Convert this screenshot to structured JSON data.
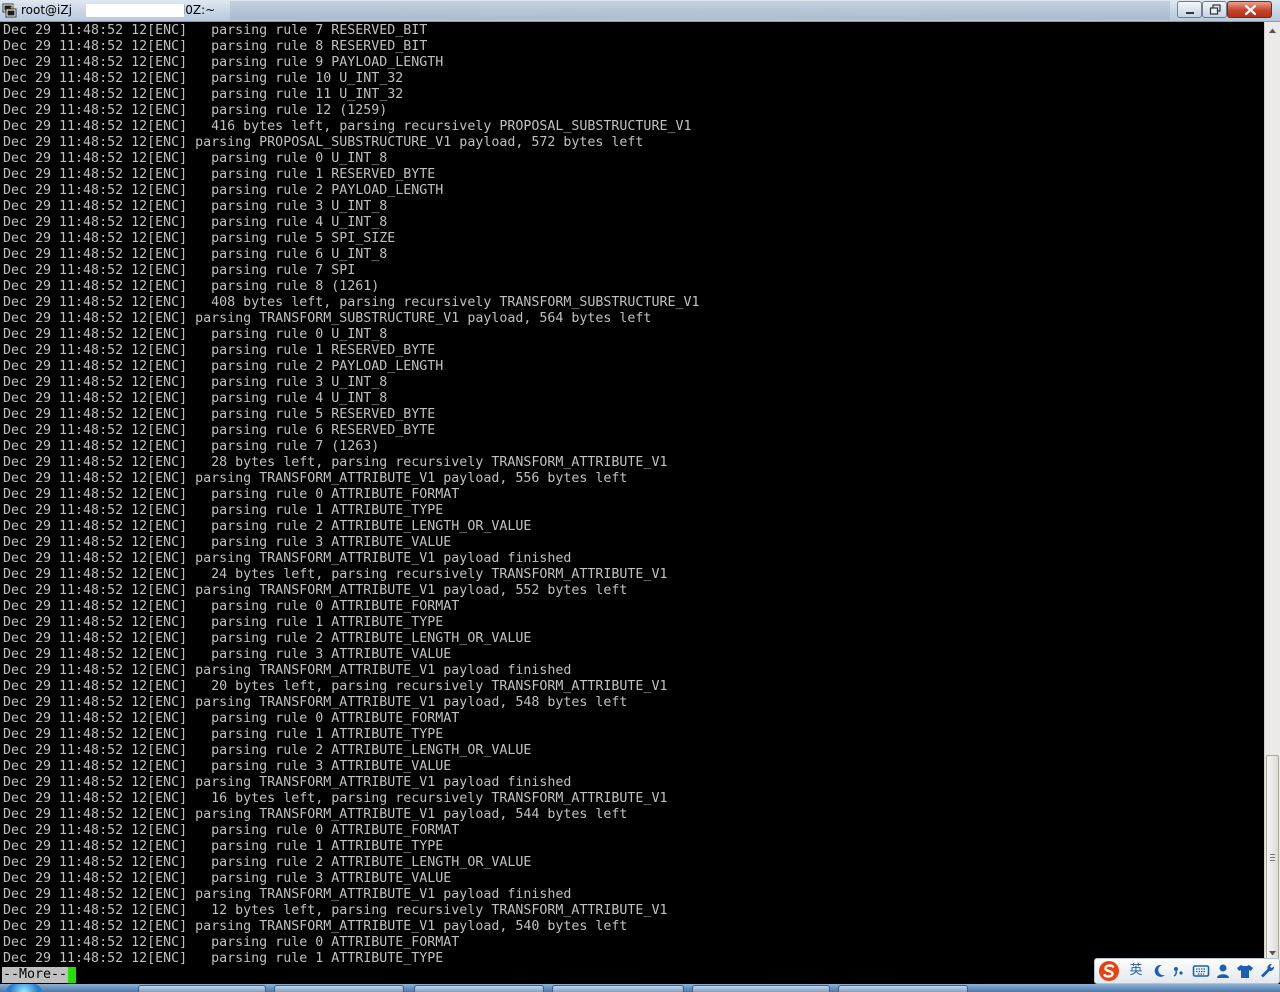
{
  "window": {
    "title": "root@iZj",
    "title_suffix": "l0Z:~",
    "minimize_label": "",
    "maximize_label": "",
    "close_label": ""
  },
  "terminal": {
    "lines": [
      "Dec 29 11:48:52 12[ENC]   parsing rule 7 RESERVED_BIT",
      "Dec 29 11:48:52 12[ENC]   parsing rule 8 RESERVED_BIT",
      "Dec 29 11:48:52 12[ENC]   parsing rule 9 PAYLOAD_LENGTH",
      "Dec 29 11:48:52 12[ENC]   parsing rule 10 U_INT_32",
      "Dec 29 11:48:52 12[ENC]   parsing rule 11 U_INT_32",
      "Dec 29 11:48:52 12[ENC]   parsing rule 12 (1259)",
      "Dec 29 11:48:52 12[ENC]   416 bytes left, parsing recursively PROPOSAL_SUBSTRUCTURE_V1",
      "Dec 29 11:48:52 12[ENC] parsing PROPOSAL_SUBSTRUCTURE_V1 payload, 572 bytes left",
      "Dec 29 11:48:52 12[ENC]   parsing rule 0 U_INT_8",
      "Dec 29 11:48:52 12[ENC]   parsing rule 1 RESERVED_BYTE",
      "Dec 29 11:48:52 12[ENC]   parsing rule 2 PAYLOAD_LENGTH",
      "Dec 29 11:48:52 12[ENC]   parsing rule 3 U_INT_8",
      "Dec 29 11:48:52 12[ENC]   parsing rule 4 U_INT_8",
      "Dec 29 11:48:52 12[ENC]   parsing rule 5 SPI_SIZE",
      "Dec 29 11:48:52 12[ENC]   parsing rule 6 U_INT_8",
      "Dec 29 11:48:52 12[ENC]   parsing rule 7 SPI",
      "Dec 29 11:48:52 12[ENC]   parsing rule 8 (1261)",
      "Dec 29 11:48:52 12[ENC]   408 bytes left, parsing recursively TRANSFORM_SUBSTRUCTURE_V1",
      "Dec 29 11:48:52 12[ENC] parsing TRANSFORM_SUBSTRUCTURE_V1 payload, 564 bytes left",
      "Dec 29 11:48:52 12[ENC]   parsing rule 0 U_INT_8",
      "Dec 29 11:48:52 12[ENC]   parsing rule 1 RESERVED_BYTE",
      "Dec 29 11:48:52 12[ENC]   parsing rule 2 PAYLOAD_LENGTH",
      "Dec 29 11:48:52 12[ENC]   parsing rule 3 U_INT_8",
      "Dec 29 11:48:52 12[ENC]   parsing rule 4 U_INT_8",
      "Dec 29 11:48:52 12[ENC]   parsing rule 5 RESERVED_BYTE",
      "Dec 29 11:48:52 12[ENC]   parsing rule 6 RESERVED_BYTE",
      "Dec 29 11:48:52 12[ENC]   parsing rule 7 (1263)",
      "Dec 29 11:48:52 12[ENC]   28 bytes left, parsing recursively TRANSFORM_ATTRIBUTE_V1",
      "Dec 29 11:48:52 12[ENC] parsing TRANSFORM_ATTRIBUTE_V1 payload, 556 bytes left",
      "Dec 29 11:48:52 12[ENC]   parsing rule 0 ATTRIBUTE_FORMAT",
      "Dec 29 11:48:52 12[ENC]   parsing rule 1 ATTRIBUTE_TYPE",
      "Dec 29 11:48:52 12[ENC]   parsing rule 2 ATTRIBUTE_LENGTH_OR_VALUE",
      "Dec 29 11:48:52 12[ENC]   parsing rule 3 ATTRIBUTE_VALUE",
      "Dec 29 11:48:52 12[ENC] parsing TRANSFORM_ATTRIBUTE_V1 payload finished",
      "Dec 29 11:48:52 12[ENC]   24 bytes left, parsing recursively TRANSFORM_ATTRIBUTE_V1",
      "Dec 29 11:48:52 12[ENC] parsing TRANSFORM_ATTRIBUTE_V1 payload, 552 bytes left",
      "Dec 29 11:48:52 12[ENC]   parsing rule 0 ATTRIBUTE_FORMAT",
      "Dec 29 11:48:52 12[ENC]   parsing rule 1 ATTRIBUTE_TYPE",
      "Dec 29 11:48:52 12[ENC]   parsing rule 2 ATTRIBUTE_LENGTH_OR_VALUE",
      "Dec 29 11:48:52 12[ENC]   parsing rule 3 ATTRIBUTE_VALUE",
      "Dec 29 11:48:52 12[ENC] parsing TRANSFORM_ATTRIBUTE_V1 payload finished",
      "Dec 29 11:48:52 12[ENC]   20 bytes left, parsing recursively TRANSFORM_ATTRIBUTE_V1",
      "Dec 29 11:48:52 12[ENC] parsing TRANSFORM_ATTRIBUTE_V1 payload, 548 bytes left",
      "Dec 29 11:48:52 12[ENC]   parsing rule 0 ATTRIBUTE_FORMAT",
      "Dec 29 11:48:52 12[ENC]   parsing rule 1 ATTRIBUTE_TYPE",
      "Dec 29 11:48:52 12[ENC]   parsing rule 2 ATTRIBUTE_LENGTH_OR_VALUE",
      "Dec 29 11:48:52 12[ENC]   parsing rule 3 ATTRIBUTE_VALUE",
      "Dec 29 11:48:52 12[ENC] parsing TRANSFORM_ATTRIBUTE_V1 payload finished",
      "Dec 29 11:48:52 12[ENC]   16 bytes left, parsing recursively TRANSFORM_ATTRIBUTE_V1",
      "Dec 29 11:48:52 12[ENC] parsing TRANSFORM_ATTRIBUTE_V1 payload, 544 bytes left",
      "Dec 29 11:48:52 12[ENC]   parsing rule 0 ATTRIBUTE_FORMAT",
      "Dec 29 11:48:52 12[ENC]   parsing rule 1 ATTRIBUTE_TYPE",
      "Dec 29 11:48:52 12[ENC]   parsing rule 2 ATTRIBUTE_LENGTH_OR_VALUE",
      "Dec 29 11:48:52 12[ENC]   parsing rule 3 ATTRIBUTE_VALUE",
      "Dec 29 11:48:52 12[ENC] parsing TRANSFORM_ATTRIBUTE_V1 payload finished",
      "Dec 29 11:48:52 12[ENC]   12 bytes left, parsing recursively TRANSFORM_ATTRIBUTE_V1",
      "Dec 29 11:48:52 12[ENC] parsing TRANSFORM_ATTRIBUTE_V1 payload, 540 bytes left",
      "Dec 29 11:48:52 12[ENC]   parsing rule 0 ATTRIBUTE_FORMAT",
      "Dec 29 11:48:52 12[ENC]   parsing rule 1 ATTRIBUTE_TYPE"
    ],
    "pager_prompt": "--More--",
    "colors": {
      "background": "#000000",
      "foreground": "#c0c0c0",
      "cursor": "#22e000"
    }
  },
  "ime_toolbar": {
    "mode_label": "英",
    "icons": [
      "sogou-logo-icon",
      "moon-icon",
      "punctuation-icon",
      "keyboard-icon",
      "user-icon",
      "shirt-icon",
      "wrench-icon"
    ]
  }
}
